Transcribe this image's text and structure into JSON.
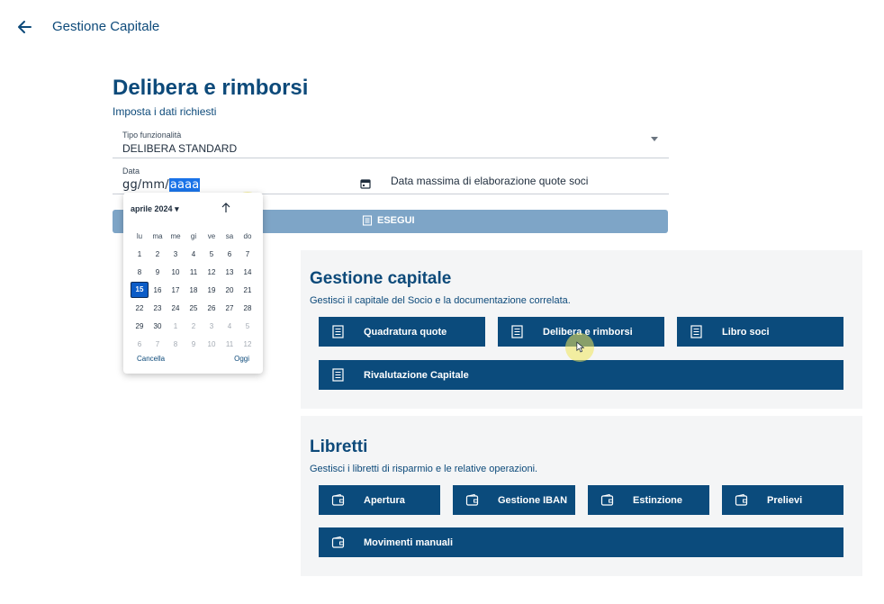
{
  "topbar": {
    "title": "Gestione Capitale"
  },
  "form": {
    "title": "Delibera e rimborsi",
    "subtitle": "Imposta i dati richiesti",
    "tipo": {
      "label": "Tipo funzionalità",
      "value": "DELIBERA STANDARD"
    },
    "data": {
      "label": "Data",
      "value_prefix": "gg/mm/",
      "value_selected": "aaaa"
    },
    "data_massima": {
      "label": "Data massima di elaborazione quote soci"
    },
    "esegui_label": "ESEGUI"
  },
  "calendar": {
    "month": "aprile 2024",
    "weekdays": [
      "lu",
      "ma",
      "me",
      "gi",
      "ve",
      "sa",
      "do"
    ],
    "weeks": [
      [
        "1",
        "2",
        "3",
        "4",
        "5",
        "6",
        "7"
      ],
      [
        "8",
        "9",
        "10",
        "11",
        "12",
        "13",
        "14"
      ],
      [
        "15",
        "16",
        "17",
        "18",
        "19",
        "20",
        "21"
      ],
      [
        "22",
        "23",
        "24",
        "25",
        "26",
        "27",
        "28"
      ],
      [
        "29",
        "30",
        "1",
        "2",
        "3",
        "4",
        "5"
      ],
      [
        "6",
        "7",
        "8",
        "9",
        "10",
        "11",
        "12"
      ]
    ],
    "selected_day": "15",
    "cancel_label": "Cancella",
    "today_label": "Oggi"
  },
  "gestione_capitale": {
    "title": "Gestione capitale",
    "subtitle": "Gestisci il capitale del Socio e la documentazione correlata.",
    "tiles": [
      "Quadratura quote",
      "Delibera e rimborsi",
      "Libro soci",
      "Rivalutazione Capitale"
    ]
  },
  "libretti": {
    "title": "Libretti",
    "subtitle": "Gestisci i libretti di risparmio e le relative operazioni.",
    "tiles": [
      "Apertura",
      "Gestione IBAN",
      "Estinzione",
      "Prelievi",
      "Movimenti manuali"
    ]
  },
  "icons": {
    "back": "arrow-left-icon",
    "calendar": "calendar-icon",
    "document": "document-list-icon",
    "wallet": "wallet-icon"
  },
  "colors": {
    "primary": "#0b4b7c",
    "disabled_button": "#7ea5c7",
    "title": "#0d4a7a"
  }
}
